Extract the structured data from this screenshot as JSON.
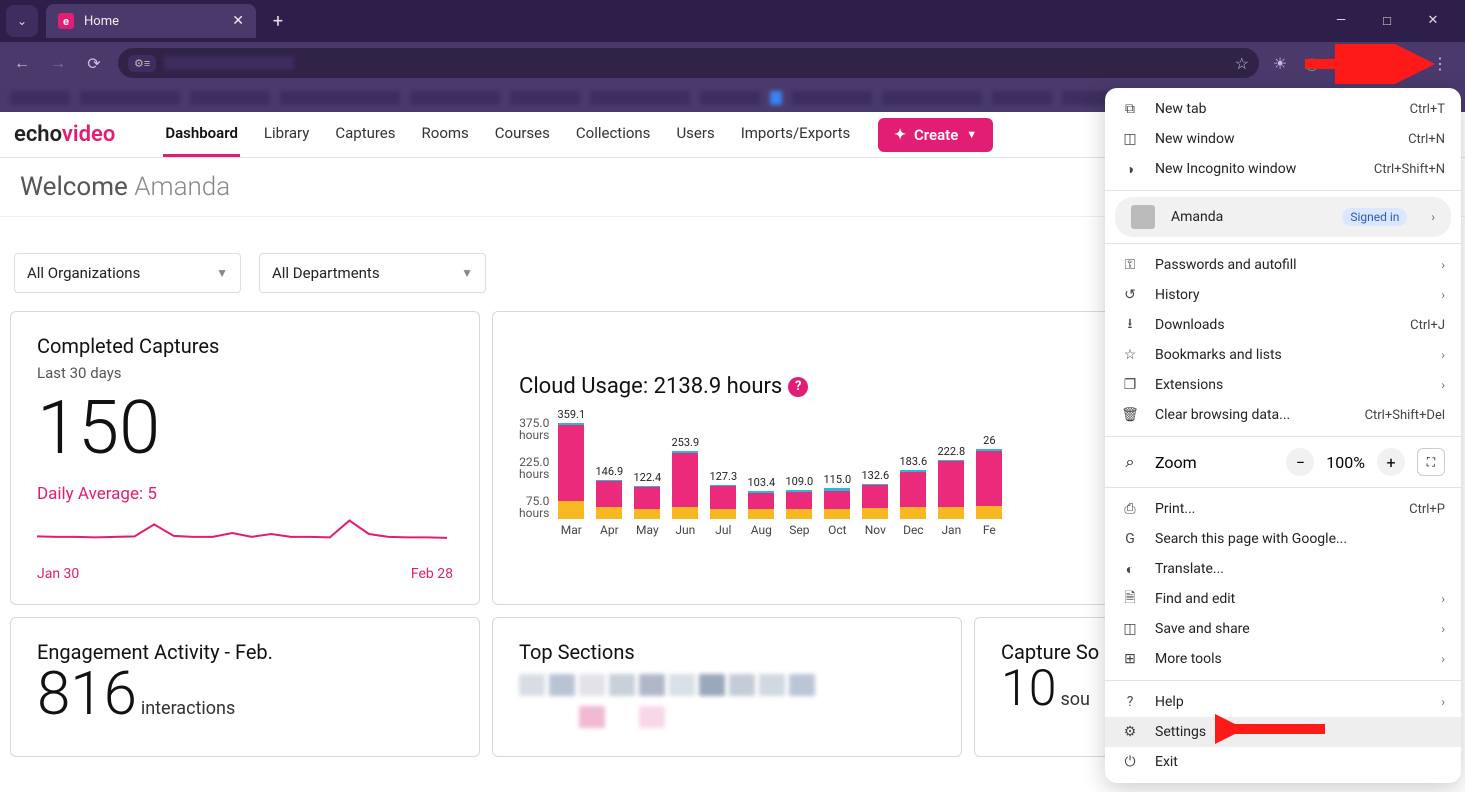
{
  "browser": {
    "tab_title": "Home",
    "window_controls": {
      "min": "—",
      "max": "□",
      "close": "✕"
    },
    "toolbar_icons": [
      "star",
      "sun",
      "circle-g",
      "puzzle",
      "sidebar",
      "avatar",
      "kebab"
    ]
  },
  "chrome_menu": {
    "items_a": [
      {
        "icon": "⧉",
        "label": "New tab",
        "shortcut": "Ctrl+T"
      },
      {
        "icon": "◫",
        "label": "New window",
        "shortcut": "Ctrl+N"
      },
      {
        "icon": "◑",
        "label": "New Incognito window",
        "shortcut": "Ctrl+Shift+N"
      }
    ],
    "account": {
      "name": "Amanda",
      "status": "Signed in"
    },
    "items_b": [
      {
        "icon": "⚿",
        "label": "Passwords and autofill",
        "arrow": true
      },
      {
        "icon": "↺",
        "label": "History",
        "arrow": true
      },
      {
        "icon": "⭳",
        "label": "Downloads",
        "shortcut": "Ctrl+J"
      },
      {
        "icon": "☆",
        "label": "Bookmarks and lists",
        "arrow": true
      },
      {
        "icon": "❐",
        "label": "Extensions",
        "arrow": true
      },
      {
        "icon": "🗑",
        "label": "Clear browsing data...",
        "shortcut": "Ctrl+Shift+Del"
      }
    ],
    "zoom": {
      "icon": "⌕",
      "label": "Zoom",
      "value": "100%"
    },
    "items_c": [
      {
        "icon": "⎙",
        "label": "Print...",
        "shortcut": "Ctrl+P"
      },
      {
        "icon": "G",
        "label": "Search this page with Google..."
      },
      {
        "icon": "◐",
        "label": "Translate..."
      },
      {
        "icon": "🗎",
        "label": "Find and edit",
        "arrow": true
      },
      {
        "icon": "◫",
        "label": "Save and share",
        "arrow": true
      },
      {
        "icon": "⊞",
        "label": "More tools",
        "arrow": true
      }
    ],
    "items_d": [
      {
        "icon": "?",
        "label": "Help",
        "arrow": true
      },
      {
        "icon": "⚙",
        "label": "Settings",
        "highlight": true
      },
      {
        "icon": "⏻",
        "label": "Exit"
      }
    ]
  },
  "app": {
    "logo_a": "echo",
    "logo_b": "video",
    "nav": [
      "Dashboard",
      "Library",
      "Captures",
      "Rooms",
      "Courses",
      "Collections",
      "Users",
      "Imports/Exports"
    ],
    "create": "Create",
    "welcome_prefix": "Welcome ",
    "welcome_name": "Amanda",
    "filters": {
      "org": "All Organizations",
      "dept": "All Departments"
    },
    "card_captures": {
      "title": "Completed Captures",
      "sub": "Last 30 days",
      "value": "150",
      "daily": "Daily Average: 5",
      "start": "Jan 30",
      "end": "Feb 28"
    },
    "card_cloud": {
      "title": "Cloud Usage: 2138.9 hours"
    },
    "card_engagement": {
      "title": "Engagement Activity - Feb.",
      "value": "816",
      "unit": "interactions"
    },
    "card_topsections": {
      "title": "Top Sections"
    },
    "card_capturesources": {
      "title": "Capture So",
      "value": "10",
      "unit": "sou"
    }
  },
  "chart_data": {
    "type": "bar",
    "title": "Cloud Usage: 2138.9 hours",
    "ylabel": "hours",
    "yticks": [
      "375.0 hours",
      "225.0 hours",
      "75.0 hours"
    ],
    "ylim": [
      0,
      375
    ],
    "categories": [
      "Mar",
      "Apr",
      "May",
      "Jun",
      "Jul",
      "Aug",
      "Sep",
      "Oct",
      "Nov",
      "Dec",
      "Jan",
      "Fe"
    ],
    "values": [
      359.1,
      146.9,
      122.4,
      253.9,
      127.3,
      103.4,
      109.0,
      115.0,
      132.6,
      183.6,
      222.8,
      263
    ],
    "value_labels": [
      "359.1",
      "146.9",
      "122.4",
      "253.9",
      "127.3",
      "103.4",
      "109.0",
      "115.0",
      "132.6",
      "183.6",
      "222.8",
      "26"
    ],
    "stack_fractions": {
      "comment": "approximate orange/pink/teal split per bar",
      "orange": [
        0.19,
        0.3,
        0.3,
        0.18,
        0.3,
        0.38,
        0.36,
        0.34,
        0.3,
        0.24,
        0.21,
        0.19
      ],
      "teal": [
        0.02,
        0.02,
        0.02,
        0.02,
        0.04,
        0.07,
        0.07,
        0.07,
        0.05,
        0.03,
        0.03,
        0.03
      ]
    }
  },
  "sparkline": {
    "points": [
      0.55,
      0.56,
      0.56,
      0.57,
      0.56,
      0.55,
      0.3,
      0.54,
      0.56,
      0.56,
      0.48,
      0.56,
      0.5,
      0.56,
      0.56,
      0.57,
      0.22,
      0.5,
      0.56,
      0.57,
      0.57,
      0.58
    ]
  }
}
